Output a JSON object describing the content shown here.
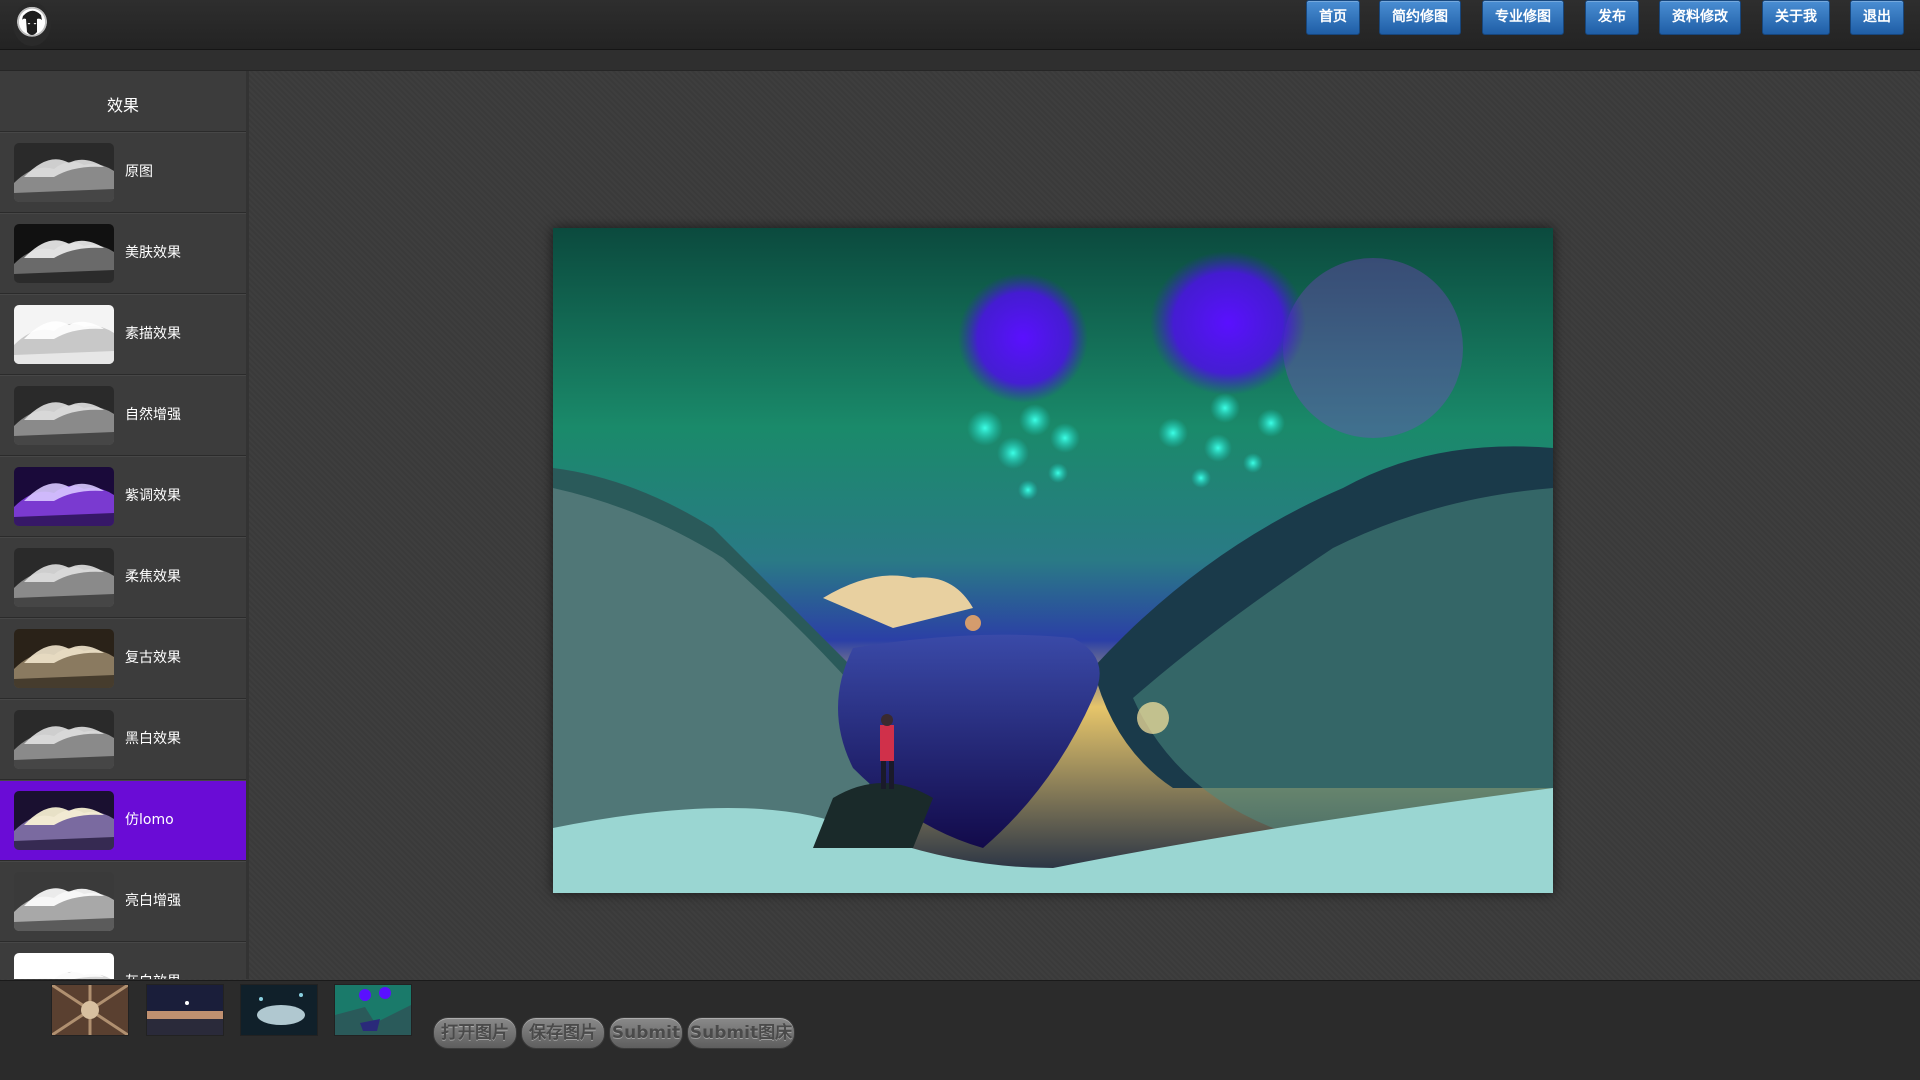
{
  "nav": {
    "items": [
      {
        "label": "首页"
      },
      {
        "label": "简约修图"
      },
      {
        "label": "专业修图"
      },
      {
        "label": "发布"
      },
      {
        "label": "资料修改"
      },
      {
        "label": "关于我"
      },
      {
        "label": "退出"
      }
    ]
  },
  "sidebar": {
    "title": "效果",
    "effects": [
      {
        "label": "原图",
        "tone": "gray"
      },
      {
        "label": "美肤效果",
        "tone": "dark"
      },
      {
        "label": "素描效果",
        "tone": "sketch"
      },
      {
        "label": "自然增强",
        "tone": "gray"
      },
      {
        "label": "紫调效果",
        "tone": "purple"
      },
      {
        "label": "柔焦效果",
        "tone": "gray"
      },
      {
        "label": "复古效果",
        "tone": "sepia"
      },
      {
        "label": "黑白效果",
        "tone": "gray"
      },
      {
        "label": "仿lomo",
        "tone": "lomo",
        "active": true
      },
      {
        "label": "亮白增强",
        "tone": "light"
      },
      {
        "label": "灰白效果",
        "tone": "white"
      }
    ],
    "active_color": "#6a0cd6"
  },
  "bottom": {
    "thumbnails": [
      "pattern-thumb",
      "night-sky-thumb",
      "underwater-thumb",
      "fjord-thumb"
    ],
    "buttons": [
      {
        "label": "打开图片"
      },
      {
        "label": "保存图片"
      },
      {
        "label": "Submit"
      },
      {
        "label": "Submit图床"
      }
    ]
  },
  "colors": {
    "nav_button": "#2f6fb8",
    "background": "#3b3b3b"
  }
}
